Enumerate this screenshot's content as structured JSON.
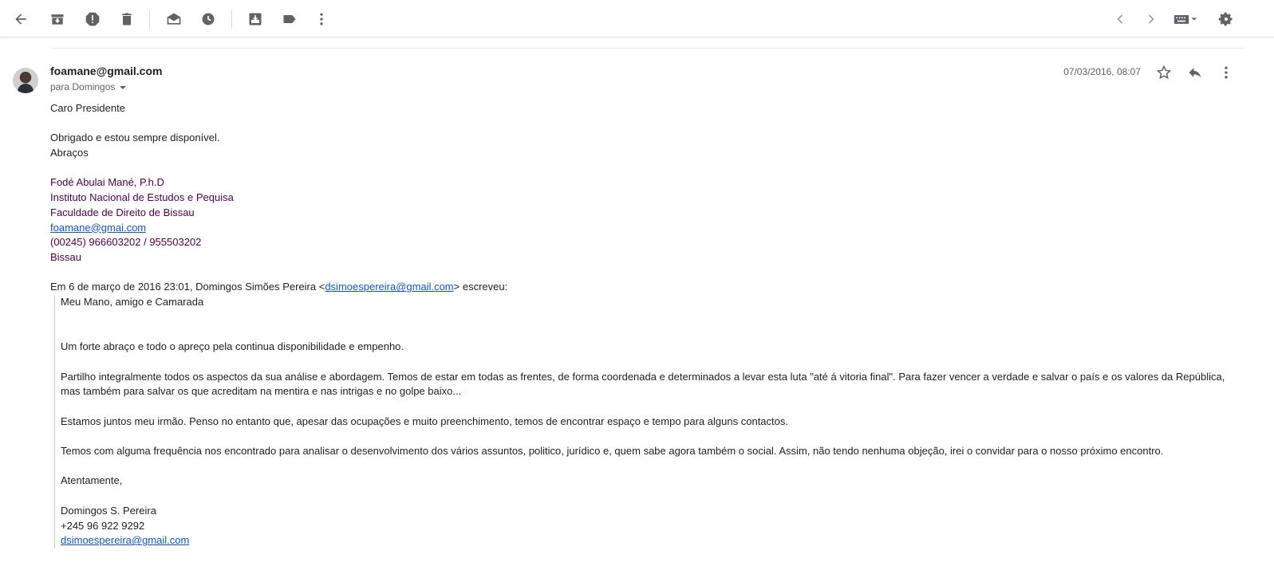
{
  "toolbar": {
    "icons": [
      "back-arrow-icon",
      "archive-icon",
      "report-spam-icon",
      "delete-icon",
      "mark-unread-icon",
      "snooze-icon",
      "move-to-icon",
      "label-icon",
      "more-vert-icon",
      "chevron-left-icon",
      "chevron-right-icon",
      "keyboard-icon",
      "settings-gear-icon"
    ]
  },
  "message": {
    "sender": "foamane@gmail.com",
    "recipient": "para Domingos",
    "date": "07/03/2016, 08:07",
    "greeting": "Caro Presidente",
    "line1": "Obrigado e estou sempre disponível.",
    "line2": "Abraços",
    "signature": {
      "name": "Fodé Abulai Mané, P.h.D",
      "org1": "Instituto Nacional de Estudos e Pequisa",
      "org2": "Faculdade de Direito de Bissau",
      "email": "foamane@gmai.com",
      "phone": "(00245) 966603202 / 955503202",
      "city": "Bissau"
    },
    "quote_header_before": "Em 6 de março de 2016 23:01, Domingos Simões Pereira <",
    "quote_header_email": "dsimoespereira@gmail.com",
    "quote_header_after": "> escreveu:",
    "quoted": {
      "greeting": "Meu Mano, amigo e Camarada",
      "p1": "Um forte abraço e todo o apreço pela continua disponibilidade e empenho.",
      "p2": "Partilho integralmente todos os aspectos da sua análise e abordagem. Temos de estar em todas as frentes, de forma coordenada e determinados a levar esta luta \"até á vitoria final\". Para fazer vencer a verdade e salvar o país e os valores da República, mas também para salvar os que acreditam na mentira e nas intrigas e no golpe baixo...",
      "p3": "Estamos juntos meu irmão. Penso no entanto que, apesar das ocupações e muito preenchimento, temos de encontrar espaço e tempo para alguns contactos.",
      "p4": "Temos com alguma frequência nos encontrado para analisar o desenvolvimento dos vários assuntos, politico, jurídico e, quem sabe agora também o social. Assim, não tendo nenhuma objeção, irei o convidar para o nosso próximo encontro.",
      "closing": "Atentamente,",
      "sig_name": "Domingos S. Pereira",
      "sig_phone": "+245 96 922 9292",
      "sig_email": "dsimoespereira@gmail.com"
    }
  }
}
